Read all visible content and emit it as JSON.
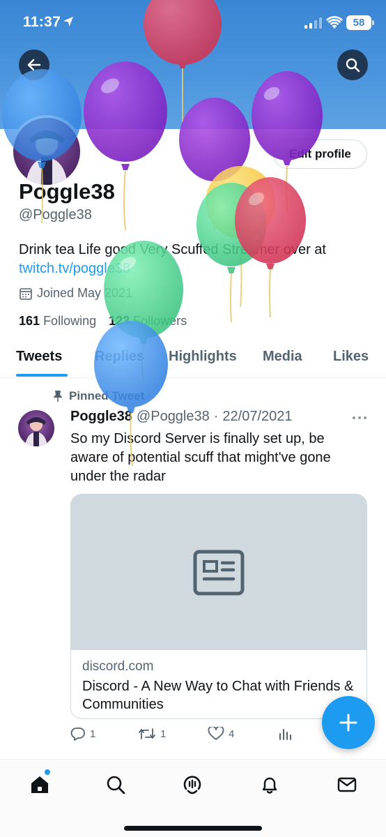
{
  "status_bar": {
    "time": "11:37",
    "battery": "58"
  },
  "header": {
    "back_icon": "back-arrow-icon",
    "search_icon": "search-icon"
  },
  "profile": {
    "edit_profile_label": "Edit profile",
    "display_name": "Poggle38",
    "handle": "@Poggle38",
    "bio_text": "Drink tea Life good Very Scuffed Streamer over at",
    "bio_link": "twitch.tv/poggle38",
    "joined": "Joined May 2021",
    "following_count": "161",
    "following_label": "Following",
    "followers_count": "123",
    "followers_label": "Followers"
  },
  "tabs": [
    {
      "label": "Tweets",
      "active": true
    },
    {
      "label": "Replies",
      "active": false
    },
    {
      "label": "Highlights",
      "active": false
    },
    {
      "label": "Media",
      "active": false
    },
    {
      "label": "Likes",
      "active": false
    }
  ],
  "tweet": {
    "pinned_label": "Pinned Tweet",
    "author_name": "Poggle38",
    "author_handle": "@Poggle38",
    "separator": "·",
    "date": "22/07/2021",
    "text": "So my Discord Server is finally set up, be aware of potential scuff that might've gone under the radar",
    "card": {
      "domain": "discord.com",
      "title": "Discord - A New Way to Chat with Friends & Communities"
    },
    "replies": "1",
    "retweets": "1",
    "likes": "4"
  },
  "colors": {
    "accent": "#1d9bf0",
    "banner": "#3a86d4",
    "text_primary": "#0f1419",
    "text_secondary": "#536471"
  },
  "bottom_nav": [
    "home-icon",
    "search-icon",
    "spaces-icon",
    "notifications-icon",
    "messages-icon"
  ]
}
